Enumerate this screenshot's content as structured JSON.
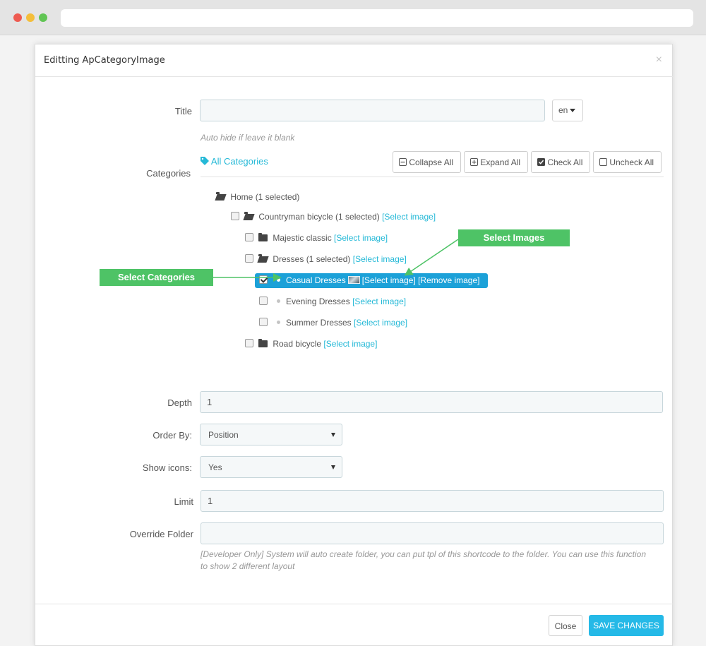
{
  "modal": {
    "title": "Editting ApCategoryImage",
    "close_glyph": "×"
  },
  "form": {
    "title": {
      "label": "Title",
      "value": "",
      "language": "en",
      "help": "Auto hide if leave it blank"
    },
    "categories": {
      "label": "Categories",
      "all_categories": "All Categories",
      "buttons": {
        "collapse_all": "Collapse All",
        "expand_all": "Expand All",
        "check_all": "Check All",
        "uncheck_all": "Uncheck All"
      },
      "tree": [
        {
          "name": "Home (1 selected)",
          "checkbox": false,
          "checked": false,
          "icon": "folder-open-icon",
          "select_link": "",
          "remove_link": ""
        },
        {
          "name": "Countryman bicycle (1 selected)",
          "checkbox": true,
          "checked": false,
          "icon": "folder-open-icon",
          "select_link": "[Select image]",
          "remove_link": ""
        },
        {
          "name": "Majestic classic",
          "checkbox": true,
          "checked": false,
          "icon": "folder-icon",
          "select_link": "[Select image]",
          "remove_link": ""
        },
        {
          "name": "Dresses (1 selected)",
          "checkbox": true,
          "checked": false,
          "icon": "folder-open-icon",
          "select_link": "[Select image]",
          "remove_link": ""
        },
        {
          "name": "Casual Dresses",
          "checkbox": true,
          "checked": true,
          "icon": "bullet",
          "select_link": "[Select image]",
          "remove_link": "[Remove image]",
          "has_thumbnail": true
        },
        {
          "name": "Evening Dresses",
          "checkbox": true,
          "checked": false,
          "icon": "bullet",
          "select_link": "[Select image]",
          "remove_link": ""
        },
        {
          "name": "Summer Dresses",
          "checkbox": true,
          "checked": false,
          "icon": "bullet",
          "select_link": "[Select image]",
          "remove_link": ""
        },
        {
          "name": "Road bicycle",
          "checkbox": true,
          "checked": false,
          "icon": "folder-icon",
          "select_link": "[Select image]",
          "remove_link": ""
        }
      ]
    },
    "depth": {
      "label": "Depth",
      "value": "1"
    },
    "order_by": {
      "label": "Order By:",
      "value": "Position"
    },
    "show_icons": {
      "label": "Show icons:",
      "value": "Yes"
    },
    "limit": {
      "label": "Limit",
      "value": "1"
    },
    "override_folder": {
      "label": "Override Folder",
      "value": "",
      "help": "[Developer Only] System will auto create folder, you can put tpl of this shortcode to the folder. You can use this function to show 2 different layout"
    }
  },
  "annotations": {
    "select_categories": "Select Categories",
    "select_images": "Select Images"
  },
  "footer": {
    "close": "Close",
    "save": "SAVE CHANGES"
  },
  "colors": {
    "accent": "#25b9d7",
    "selected_row": "#1ca1d8",
    "annotation": "#4ec366",
    "save_button": "#25b9e7"
  }
}
